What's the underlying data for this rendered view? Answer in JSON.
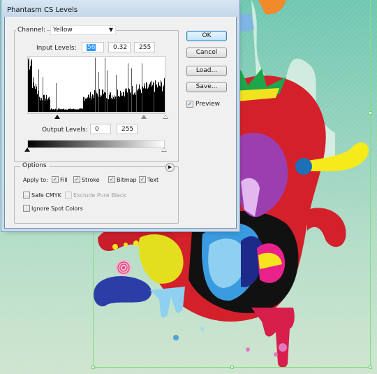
{
  "dialog": {
    "title": "Phantasm CS Levels",
    "channel": {
      "label": "Channel:",
      "value": "Yellow"
    },
    "input_levels": {
      "label": "Input Levels:",
      "black": "56",
      "gamma": "0.32",
      "white": "255"
    },
    "output_levels": {
      "label": "Output Levels:",
      "black": "0",
      "white": "255"
    },
    "histogram": {
      "input_black_slider": 56,
      "input_gamma_slider": 0.32,
      "input_white_slider": 255,
      "range": [
        0,
        255
      ]
    },
    "output_sliders": {
      "black": 0,
      "white": 255
    },
    "buttons": {
      "ok": "OK",
      "cancel": "Cancel",
      "load": "Load...",
      "save": "Save..."
    },
    "preview": {
      "label": "Preview",
      "checked": true
    },
    "options": {
      "title": "Options",
      "apply_to_label": "Apply to:",
      "apply_to": [
        {
          "label": "Fill",
          "checked": true
        },
        {
          "label": "Stroke",
          "checked": true
        },
        {
          "label": "Bitmap",
          "checked": true
        },
        {
          "label": "Text",
          "checked": true
        }
      ],
      "safe_cmyk": {
        "label": "Safe CMYK",
        "checked": false
      },
      "exclude_pure_black": {
        "label": "Exclude Pure Black",
        "checked": false,
        "disabled": true
      },
      "ignore_spot_colors": {
        "label": "Ignore Spot Colors",
        "checked": false
      }
    }
  },
  "colors": {
    "background_top": "#6fc7b1",
    "background_bottom": "#cfe5cf",
    "selection_frame": "#7fe07f",
    "default_button": "#bee6fd",
    "text_selection": "#3399ff"
  }
}
